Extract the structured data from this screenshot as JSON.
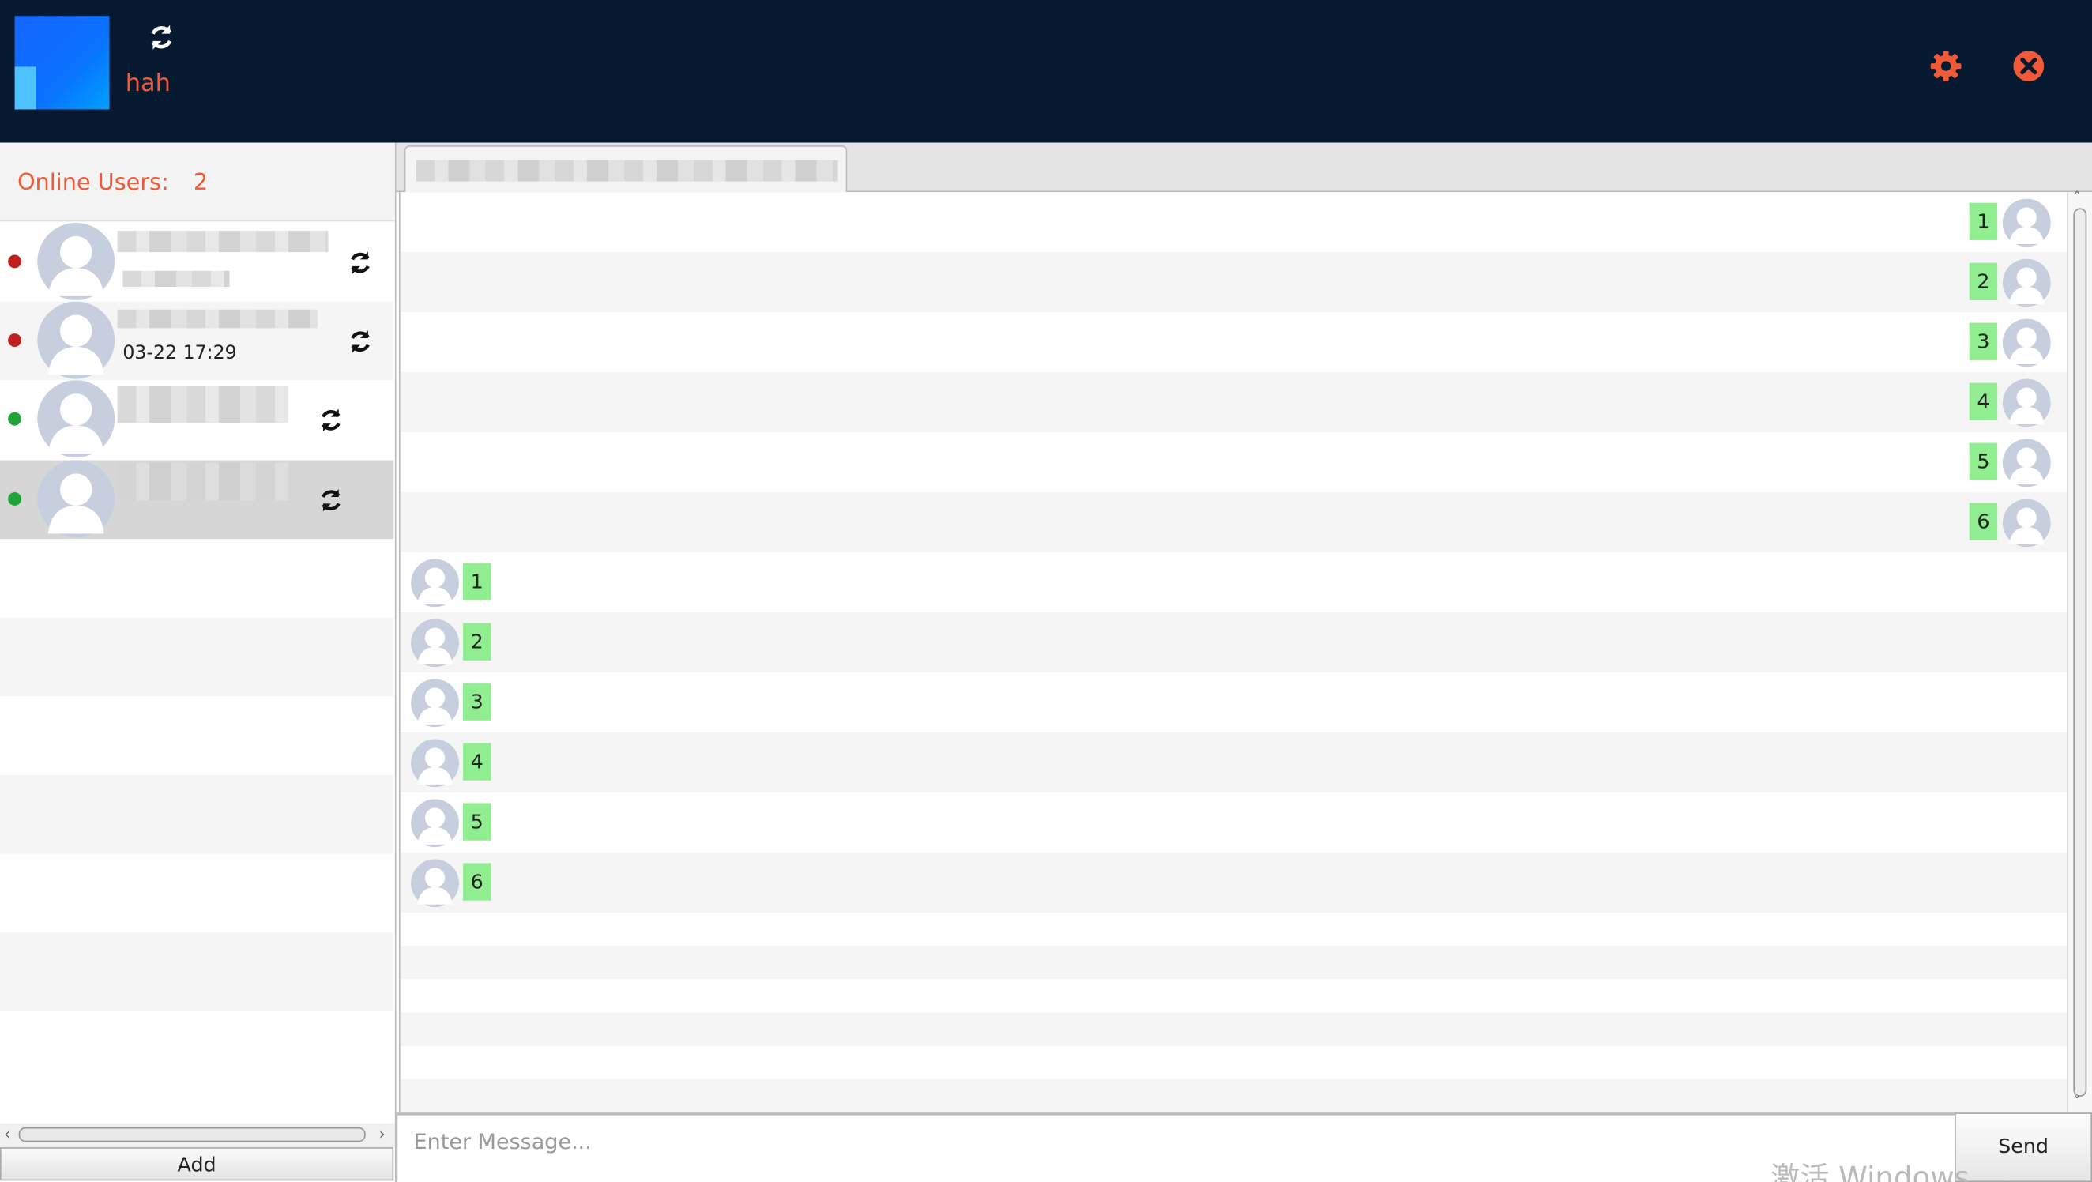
{
  "header": {
    "username": "hah",
    "accent_color": "#f05a38",
    "background_color": "#051a30"
  },
  "sidebar": {
    "online_label": "Online Users:",
    "online_count": "2",
    "users": [
      {
        "status": "offline",
        "status_color": "#c0211f",
        "time": ""
      },
      {
        "status": "offline",
        "status_color": "#c0211f",
        "time": "03-22 17:29"
      },
      {
        "status": "online",
        "status_color": "#22a33a",
        "time": ""
      },
      {
        "status": "online",
        "status_color": "#22a33a",
        "time": ""
      }
    ],
    "add_label": "Add"
  },
  "chat": {
    "sent_messages": [
      "1",
      "2",
      "3",
      "4",
      "5",
      "6"
    ],
    "received_messages": [
      "1",
      "2",
      "3",
      "4",
      "5",
      "6"
    ],
    "input_placeholder": "Enter Message...",
    "send_label": "Send",
    "bubble_color": "#90ee90"
  },
  "watermark": "激活 Windows"
}
